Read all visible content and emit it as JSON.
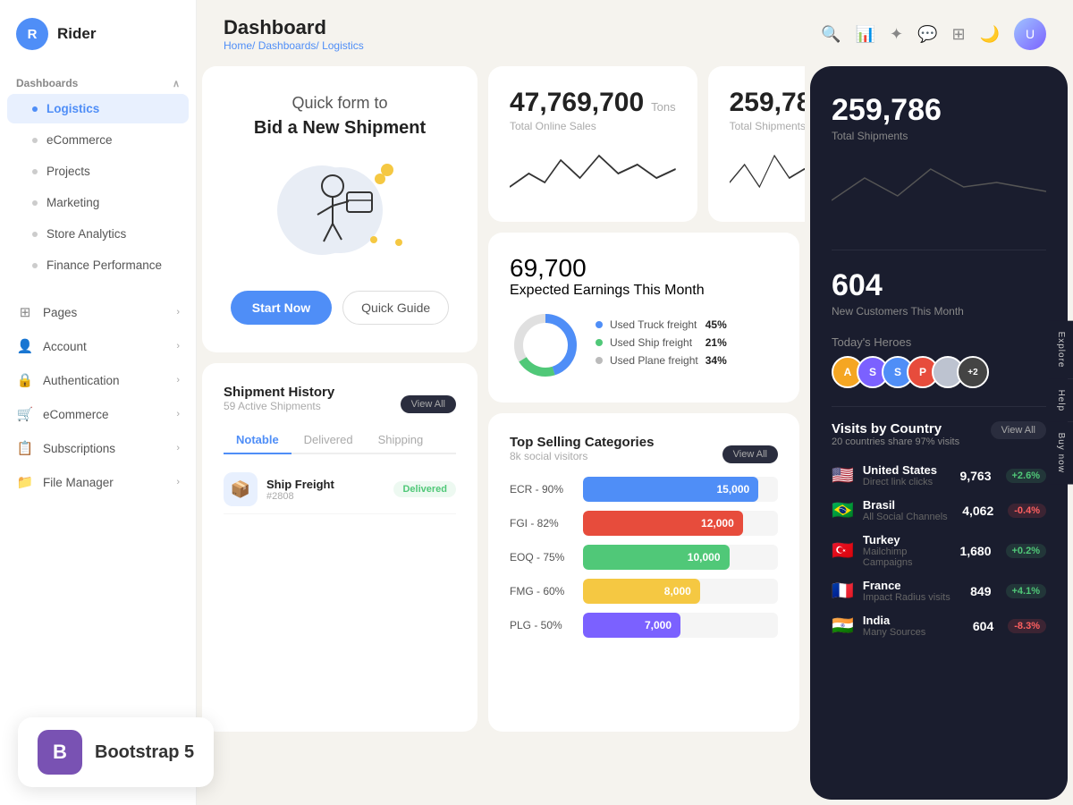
{
  "app": {
    "logo_letter": "R",
    "app_name": "Rider"
  },
  "sidebar": {
    "dashboards_label": "Dashboards",
    "items": [
      {
        "id": "logistics",
        "label": "Logistics",
        "active": true
      },
      {
        "id": "ecommerce",
        "label": "eCommerce",
        "active": false
      },
      {
        "id": "projects",
        "label": "Projects",
        "active": false
      },
      {
        "id": "marketing",
        "label": "Marketing",
        "active": false
      },
      {
        "id": "store-analytics",
        "label": "Store Analytics",
        "active": false
      },
      {
        "id": "finance-performance",
        "label": "Finance Performance",
        "active": false
      }
    ],
    "pages_label": "Pages",
    "pages_chevron": "›",
    "account_label": "Account",
    "auth_label": "Authentication",
    "ecommerce_label": "eCommerce",
    "subscriptions_label": "Subscriptions",
    "file_manager_label": "File Manager"
  },
  "header": {
    "title": "Dashboard",
    "breadcrumb_home": "Home/",
    "breadcrumb_dashboards": "Dashboards/",
    "breadcrumb_current": "Logistics"
  },
  "bid_card": {
    "line1": "Quick form to",
    "line2": "Bid a New Shipment",
    "btn_start": "Start Now",
    "btn_guide": "Quick Guide"
  },
  "stats": {
    "online_sales_value": "47,769,700",
    "online_sales_unit": "Tons",
    "online_sales_label": "Total Online Sales",
    "shipments_value": "259,786",
    "shipments_label": "Total Shipments",
    "earnings_value": "69,700",
    "earnings_label": "Expected Earnings This Month",
    "customers_value": "604",
    "customers_label": "New Customers This Month"
  },
  "freight": {
    "truck": {
      "label": "Used Truck freight",
      "pct": "45%",
      "value": 45,
      "color": "#4f8ef7"
    },
    "ship": {
      "label": "Used Ship freight",
      "pct": "21%",
      "value": 21,
      "color": "#50c878"
    },
    "plane": {
      "label": "Used Plane freight",
      "pct": "34%",
      "value": 34,
      "color": "#e0e0e0"
    }
  },
  "heroes": {
    "label": "Today's Heroes",
    "avatars": [
      {
        "color": "#f5a623",
        "letter": "A"
      },
      {
        "color": "#7b61ff",
        "letter": "S"
      },
      {
        "color": "#4f8ef7",
        "letter": "S"
      },
      {
        "color": "#e74c3c",
        "letter": "P"
      },
      {
        "color": "#bdc3d0",
        "letter": ""
      },
      {
        "color": "#555",
        "letter": "+2"
      }
    ]
  },
  "right_panel": {
    "stat1_value": "259,786",
    "stat1_label": "Total Shipments",
    "stat2_value": "604",
    "stat2_label": "New Customers This Month",
    "heroes_label": "Today's Heroes",
    "visits_title": "Visits by Country",
    "visits_subtitle": "20 countries share 97% visits",
    "view_all": "View All",
    "countries": [
      {
        "flag": "🇺🇸",
        "name": "United States",
        "sub": "Direct link clicks",
        "val": "9,763",
        "change": "+2.6%",
        "pos": true
      },
      {
        "flag": "🇧🇷",
        "name": "Brasil",
        "sub": "All Social Channels",
        "val": "4,062",
        "change": "-0.4%",
        "pos": false
      },
      {
        "flag": "🇹🇷",
        "name": "Turkey",
        "sub": "Mailchimp Campaigns",
        "val": "1,680",
        "change": "+0.2%",
        "pos": true
      },
      {
        "flag": "🇫🇷",
        "name": "France",
        "sub": "Impact Radius visits",
        "val": "849",
        "change": "+4.1%",
        "pos": true
      },
      {
        "flag": "🇮🇳",
        "name": "India",
        "sub": "Many Sources",
        "val": "604",
        "change": "-8.3%",
        "pos": false
      }
    ]
  },
  "shipment_history": {
    "title": "Shipment History",
    "subtitle": "59 Active Shipments",
    "view_all": "View All",
    "tabs": [
      "Notable",
      "Delivered",
      "Shipping"
    ],
    "active_tab": "Notable",
    "rows": [
      {
        "icon": "📦",
        "name": "Ship Freight",
        "num": "#2808",
        "status": "Delivered",
        "status_color": "#50c878"
      }
    ]
  },
  "categories": {
    "title": "Top Selling Categories",
    "subtitle": "8k social visitors",
    "view_all": "View All",
    "bars": [
      {
        "label": "ECR - 90%",
        "value": 90,
        "display": "15,000",
        "color": "#4f8ef7"
      },
      {
        "label": "FGI - 82%",
        "value": 82,
        "display": "12,000",
        "color": "#e74c3c"
      },
      {
        "label": "EOQ - 75%",
        "value": 75,
        "display": "10,000",
        "color": "#50c878"
      },
      {
        "label": "FMG - 60%",
        "value": 60,
        "display": "8,000",
        "color": "#f5c842"
      },
      {
        "label": "PLG - 50%",
        "value": 50,
        "display": "7,000",
        "color": "#7b61ff"
      }
    ]
  },
  "bootstrap_badge": {
    "icon": "B",
    "label": "Bootstrap 5"
  }
}
